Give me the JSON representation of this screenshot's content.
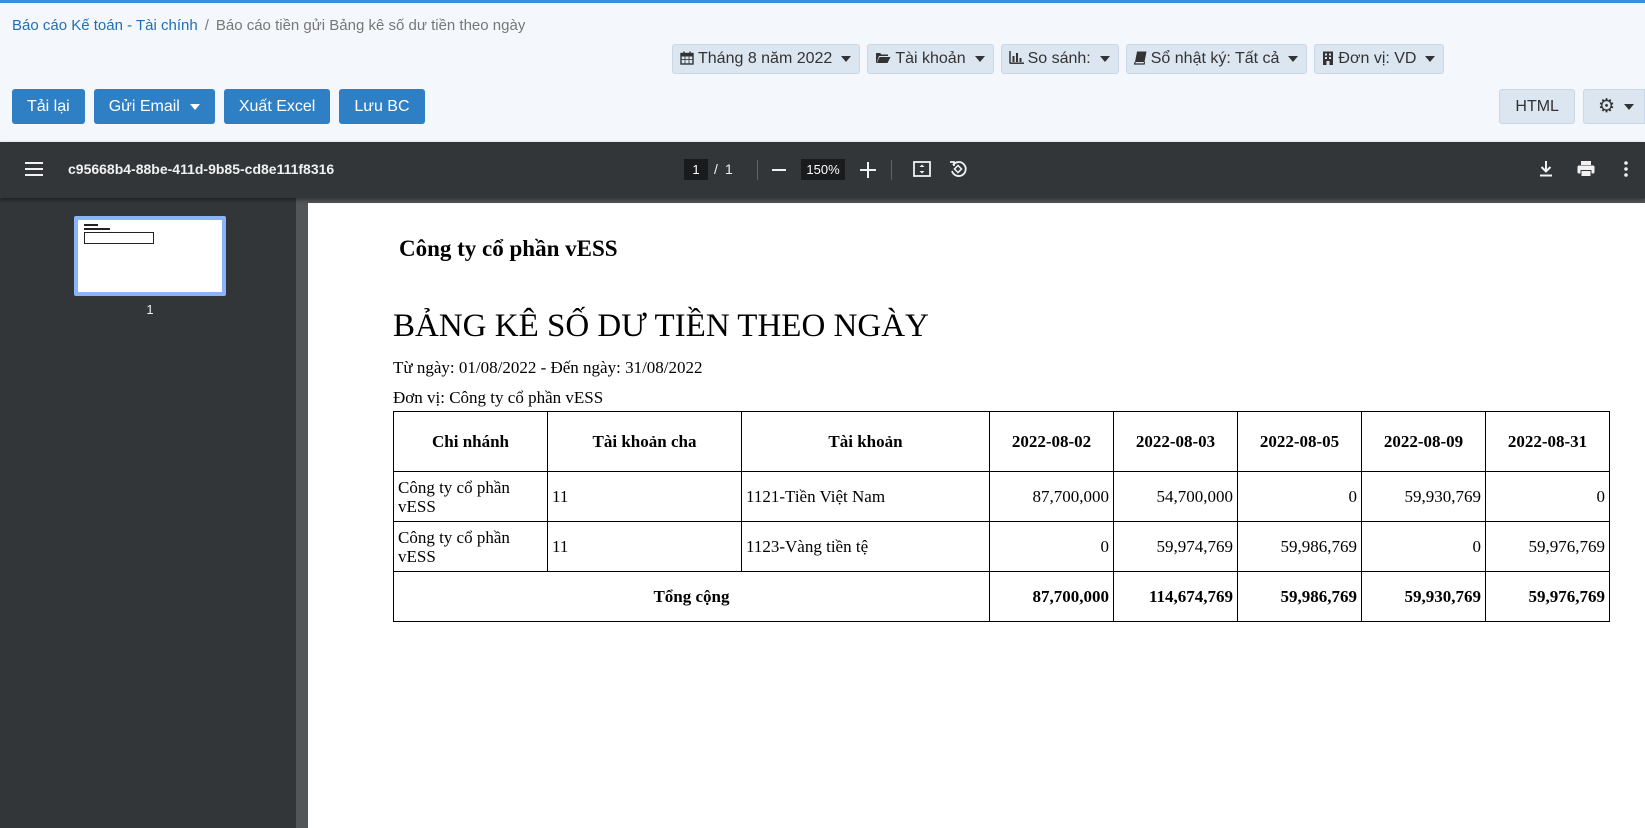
{
  "breadcrumb": {
    "parent": "Báo cáo Kế toán - Tài chính",
    "separator": "/",
    "current": "Báo cáo tiền gửi Bảng kê số dư tiền theo ngày"
  },
  "filters": [
    {
      "icon": "calendar-icon",
      "label": "Tháng 8 năm 2022"
    },
    {
      "icon": "folder-open-icon",
      "label": "Tài khoản"
    },
    {
      "icon": "bar-chart-icon",
      "label": "So sánh:"
    },
    {
      "icon": "book-icon",
      "label": "Sổ nhật ký: Tất cả"
    },
    {
      "icon": "building-icon",
      "label": "Đơn vị: VD"
    }
  ],
  "actions": {
    "reload": "Tải lại",
    "send_email": "Gửi Email",
    "export_excel": "Xuất Excel",
    "save_report": "Lưu BC",
    "html": "HTML"
  },
  "viewer": {
    "file_name": "c95668b4-88be-411d-9b85-cd8e111f8316",
    "current_page": "1",
    "page_separator": "/",
    "total_pages": "1",
    "zoom": "150%",
    "thumbnail_label": "1"
  },
  "report": {
    "company": "Công ty cổ phần vESS",
    "title": "BẢNG KÊ SỐ DƯ TIỀN THEO NGÀY",
    "date_range": "Từ ngày: 01/08/2022 - Đến ngày: 31/08/2022",
    "unit": "Đơn vị: Công ty cổ phần vESS",
    "columns": [
      "Chi nhánh",
      "Tài khoản cha",
      "Tài khoản",
      "2022-08-02",
      "2022-08-03",
      "2022-08-05",
      "2022-08-09",
      "2022-08-31"
    ],
    "rows": [
      [
        "Công ty cổ phần vESS",
        "11",
        "1121-Tiền Việt Nam",
        "87,700,000",
        "54,700,000",
        "0",
        "59,930,769",
        "0"
      ],
      [
        "Công ty cổ phần vESS",
        "11",
        "1123-Vàng tiền tệ",
        "0",
        "59,974,769",
        "59,986,769",
        "0",
        "59,976,769"
      ]
    ],
    "total": {
      "label": "Tổng cộng",
      "values": [
        "87,700,000",
        "114,674,769",
        "59,986,769",
        "59,930,769",
        "59,976,769"
      ]
    }
  },
  "colors": {
    "primary": "#2f7fc5",
    "link": "#1f6fb5",
    "viewer_toolbar": "#323639",
    "viewer_background": "#525659"
  }
}
